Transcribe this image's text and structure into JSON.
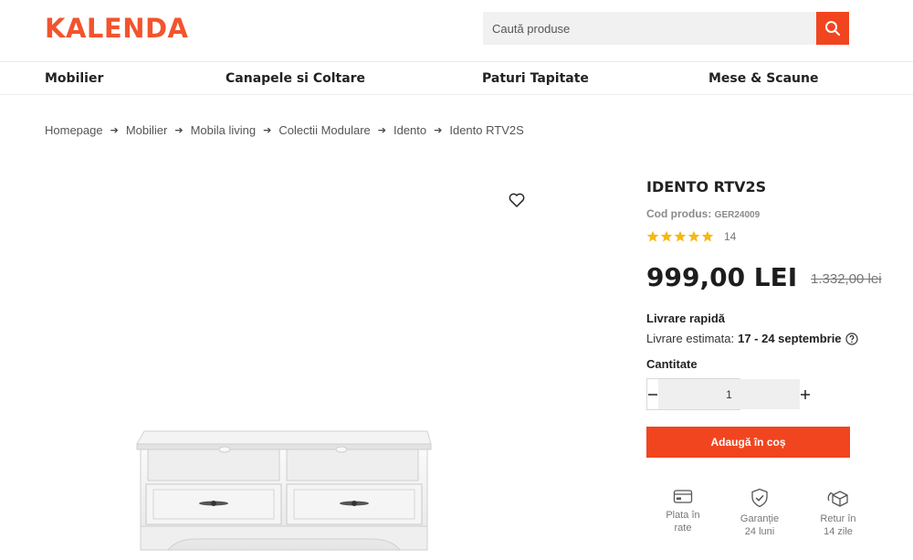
{
  "header": {
    "logo": "KALENDA",
    "search_placeholder": "Caută produse",
    "search_icon": "search-icon",
    "accent_color": "#f1451f"
  },
  "nav": {
    "items": [
      "Mobilier",
      "Canapele si Coltare",
      "Paturi Tapitate",
      "Mese & Scaune"
    ]
  },
  "breadcrumb": [
    "Homepage",
    "Mobilier",
    "Mobila living",
    "Colectii Modulare",
    "Idento",
    "Idento RTV2S"
  ],
  "product": {
    "title": "IDENTO RTV2S",
    "code_label": "Cod produs:",
    "code_value": "GER24009",
    "rating": 5,
    "rating_count": "14",
    "price": "999,00 LEI",
    "old_price": "1.332,00 lei",
    "delivery_title": "Livrare rapidă",
    "delivery_est_label": "Livrare estimata:",
    "delivery_est_value": "17 - 24 septembrie",
    "quantity_label": "Cantitate",
    "quantity_value": "1",
    "add_to_cart": "Adaugă în coș",
    "favorite_icon": "heart-icon"
  },
  "benefits": [
    {
      "icon": "card-icon",
      "line1": "Plata în",
      "line2": "rate"
    },
    {
      "icon": "shield-icon",
      "line1": "Garanție",
      "line2": "24 luni"
    },
    {
      "icon": "return-box-icon",
      "line1": "Retur în",
      "line2": "14 zile"
    }
  ]
}
